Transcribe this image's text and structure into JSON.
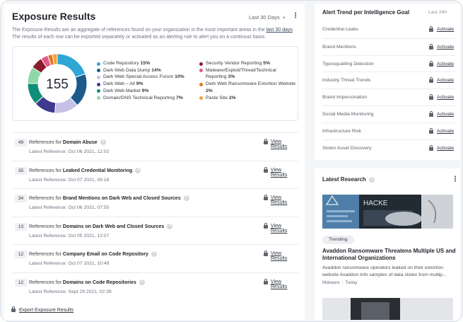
{
  "exposure": {
    "title": "Exposure Results",
    "range": "Last 30 Days",
    "intro_pre": "The Exposure Results are an aggregate of references found on your organization in the most important areas in the ",
    "intro_link": "last 30 days",
    "intro_post": ". The results of each row can be exported separately or activated as an alerting rule to alert you on a continous basis.",
    "total": "155",
    "legend_left": [
      {
        "label": "Code Repository",
        "pct": "15%",
        "value": 15,
        "color": "#2fa7d6"
      },
      {
        "label": "Dark Web Data Dump",
        "pct": "14%",
        "value": 14,
        "color": "#1d5a8c"
      },
      {
        "label": "Dark Web Special Access Forum",
        "pct": "10%",
        "value": 10,
        "color": "#c4c0e6"
      },
      {
        "label": "Dark Web – All",
        "pct": "9%",
        "value": 9,
        "color": "#3f3a8f"
      },
      {
        "label": "Dark Web Market",
        "pct": "9%",
        "value": 9,
        "color": "#0f8f7a"
      },
      {
        "label": "Domain/DNS Technical Reporting",
        "pct": "7%",
        "value": 7,
        "color": "#8ed9a8"
      }
    ],
    "legend_right": [
      {
        "label": "Security Vendor Reporting",
        "pct": "5%",
        "value": 5,
        "color": "#8c1b2f"
      },
      {
        "label": "Malware/Exploit/Threat/Technical Reporting",
        "pct": "3%",
        "value": 3,
        "color": "#e05a8a"
      },
      {
        "label": "Dark Web Ransomware Extortion Website",
        "pct": "2%",
        "value": 2,
        "color": "#e07a1f"
      },
      {
        "label": "Paste Site",
        "pct": "2%",
        "value": 2,
        "color": "#f2a33a"
      }
    ],
    "rows": [
      {
        "count": "49",
        "prefix": "References for ",
        "bold": "Domain Abuse",
        "latest": "Latest Reference: Oct 06 2021, 12:02",
        "action": "View Results"
      },
      {
        "count": "35",
        "prefix": "References for ",
        "bold": "Leaked Credential Monitoring",
        "latest": "Latest Reference: Oct 07 2021, 09:18",
        "action": "View Results"
      },
      {
        "count": "34",
        "prefix": "References for ",
        "bold": "Brand Mentions on Dark Web and Closed Sources",
        "latest": "Latest Reference: Oct 06 2021, 07:55",
        "action": "View Results"
      },
      {
        "count": "13",
        "prefix": "References for ",
        "bold": "Domains on Dark Web and Closed Sources",
        "latest": "Latest Reference: Oct 05 2021, 12:07",
        "action": "View Results"
      },
      {
        "count": "12",
        "prefix": "References for ",
        "bold": "Company Email on Code Repository",
        "latest": "Latest Reference: Oct 07 2021, 10:49",
        "action": "View Results"
      },
      {
        "count": "12",
        "prefix": "References for ",
        "bold": "Domains on Code Repositories",
        "latest": "Latest Reference: Sept 29 2021, 02:39",
        "action": "View Results"
      }
    ],
    "export": "Export Exposure Results"
  },
  "alerts": {
    "title": "Alert Trend per Intelligence Goal",
    "range": "Last 24h",
    "action": "Activate",
    "items": [
      "Credential Leaks",
      "Brand Mentions",
      "Typosquatting Detection",
      "Industry Threat Trends",
      "Brand Impersonation",
      "Social Media Monitoring",
      "Infrastructure Risk",
      "Stolen Asset Discovery"
    ]
  },
  "research": {
    "title": "Latest Research",
    "tag": "Trending",
    "headline": "Avaddon Ransomware Threatens Multiple US and International Organizations",
    "desc": "Avaddon ransomware operators leaked on their extortion website Avaddon Info samples of data stolen from multip...",
    "source": "Malware",
    "date": "Today",
    "hero_text": "HACKE"
  }
}
